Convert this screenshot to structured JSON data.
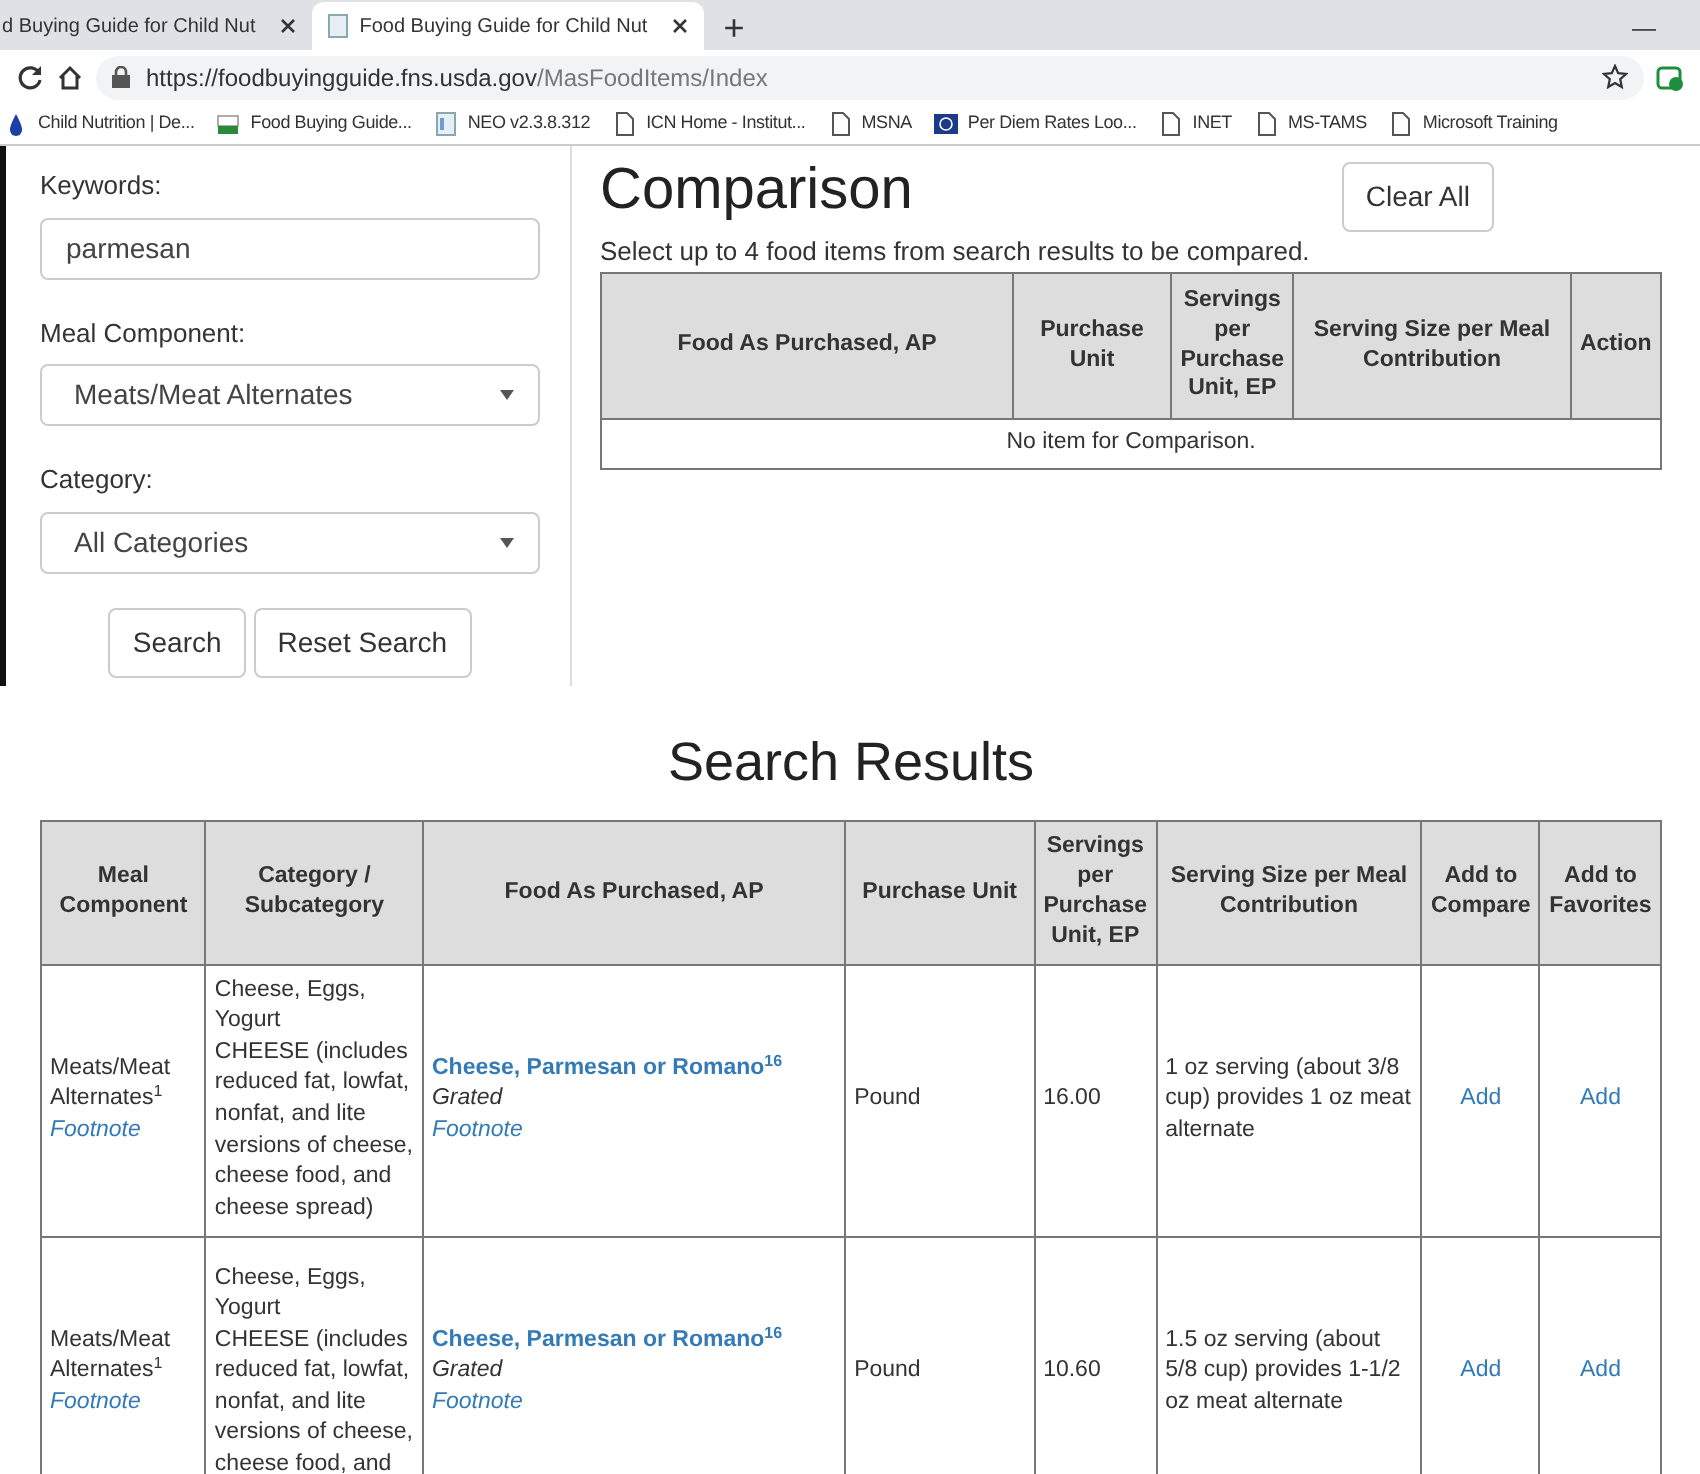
{
  "browser": {
    "tabs": [
      {
        "title": "d Buying Guide for Child Nut",
        "selected": false
      },
      {
        "title": "Food Buying Guide for Child Nut",
        "selected": true
      }
    ],
    "new_tab": "+",
    "minimize": "—",
    "url": {
      "host": "https://foodbuyingguide.fns.usda.gov",
      "path": "/MasFoodItems/Index"
    },
    "bookmarks": [
      {
        "label": "Child Nutrition | De...",
        "kind": "drop"
      },
      {
        "label": "Food Buying Guide...",
        "kind": "flag"
      },
      {
        "label": "NEO v2.3.8.312",
        "kind": "image"
      },
      {
        "label": "ICN Home - Institut...",
        "kind": "page"
      },
      {
        "label": "MSNA",
        "kind": "page"
      },
      {
        "label": "Per Diem Rates Loo...",
        "kind": "seal"
      },
      {
        "label": "INET",
        "kind": "page"
      },
      {
        "label": "MS-TAMS",
        "kind": "page"
      },
      {
        "label": "Microsoft Training",
        "kind": "page"
      }
    ]
  },
  "search_form": {
    "fields": [
      {
        "label": "Keywords:",
        "kind": "text",
        "value": "parmesan"
      },
      {
        "label": "Meal Component:",
        "kind": "select",
        "value": "Meats/Meat Alternates"
      },
      {
        "label": "Category:",
        "kind": "select",
        "value": "All Categories"
      }
    ],
    "buttons": [
      "Search",
      "Reset Search"
    ]
  },
  "comparison": {
    "title": "Comparison",
    "clear_button": "Clear All",
    "hint": "Select up to 4 food items from search results to be compared.",
    "columns": [
      "Food As Purchased, AP",
      "Purchase Unit",
      "Servings per Purchase Unit, EP",
      "Serving Size per Meal Contribution",
      "Action"
    ],
    "empty_message": "No item for Comparison."
  },
  "results": {
    "title": "Search Results",
    "columns": [
      "Meal Component",
      "Category / Subcategory",
      "Food As Purchased, AP",
      "Purchase Unit",
      "Servings per Purchase Unit, EP",
      "Serving Size per Meal Contribution",
      "Add to Compare",
      "Add to Favorites"
    ],
    "rows": [
      {
        "meal_component": "Meats/Meat Alternates$^{1}$",
        "meal_footnote": "Footnote",
        "category": "Cheese, Eggs, Yogurt",
        "subcategory": "CHEESE (includes reduced fat, lowfat, nonfat, and lite versions of cheese, cheese food, and cheese spread)",
        "food": "Cheese, Parmesan or Romano$^{16}$",
        "form": "Grated",
        "food_footnote": "Footnote",
        "unit": "Pound",
        "servings": "16.00",
        "serving_size": "1 oz serving (about 3/8 cup) provides 1 oz meat alternate",
        "compare": "Add",
        "favorite": "Add"
      },
      {
        "meal_component": "Meats/Meat Alternates$^{1}$",
        "meal_footnote": "Footnote",
        "category": "Cheese, Eggs, Yogurt",
        "subcategory": "CHEESE (includes reduced fat, lowfat, nonfat, and lite versions of cheese, cheese food, and",
        "food": "Cheese, Parmesan or Romano$^{16}$",
        "form": "Grated",
        "food_footnote": "Footnote",
        "unit": "Pound",
        "servings": "10.60",
        "serving_size": "1.5 oz serving (about 5/8 cup) provides 1-1/2 oz meat alternate",
        "compare": "Add",
        "favorite": "Add"
      }
    ]
  }
}
